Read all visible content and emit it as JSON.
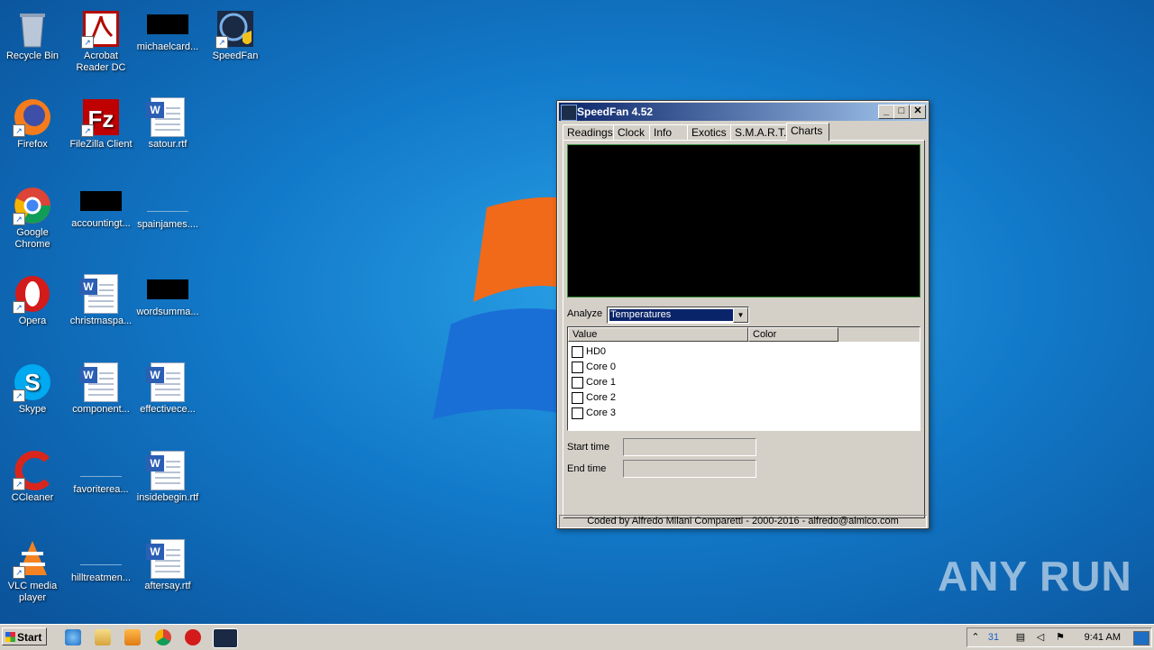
{
  "desktop": {
    "icons": [
      {
        "label": "Recycle Bin",
        "icon": "recycle-bin-icon"
      },
      {
        "label": "Acrobat Reader DC",
        "icon": "acrobat-icon"
      },
      {
        "label": "michaelcard...",
        "icon": "blank-file-icon"
      },
      {
        "label": "SpeedFan",
        "icon": "speedfan-icon"
      },
      {
        "label": "Firefox",
        "icon": "firefox-icon"
      },
      {
        "label": "FileZilla Client",
        "icon": "filezilla-icon"
      },
      {
        "label": "satour.rtf",
        "icon": "word-doc-icon"
      },
      {
        "label": "Google Chrome",
        "icon": "chrome-icon"
      },
      {
        "label": "accountingt...",
        "icon": "blank-file-icon"
      },
      {
        "label": "spainjames....",
        "icon": "blank-file-icon"
      },
      {
        "label": "Opera",
        "icon": "opera-icon"
      },
      {
        "label": "christmaspa...",
        "icon": "word-doc-icon"
      },
      {
        "label": "wordsumma...",
        "icon": "blank-file-icon"
      },
      {
        "label": "Skype",
        "icon": "skype-icon"
      },
      {
        "label": "component...",
        "icon": "word-doc-icon"
      },
      {
        "label": "effectivece...",
        "icon": "word-doc-icon"
      },
      {
        "label": "CCleaner",
        "icon": "ccleaner-icon"
      },
      {
        "label": "favoriterea...",
        "icon": "blank-file-icon"
      },
      {
        "label": "insidebegin.rtf",
        "icon": "word-doc-icon"
      },
      {
        "label": "VLC media player",
        "icon": "vlc-icon"
      },
      {
        "label": "hilltreatmen...",
        "icon": "blank-file-icon"
      },
      {
        "label": "aftersay.rtf",
        "icon": "word-doc-icon"
      }
    ]
  },
  "window": {
    "title": "SpeedFan 4.52",
    "tabs": [
      "Readings",
      "Clock",
      "Info",
      "Exotics",
      "S.M.A.R.T.",
      "Charts"
    ],
    "active_tab": "Charts",
    "analyze_label": "Analyze",
    "analyze_value": "Temperatures",
    "columns": [
      "Value",
      "Color"
    ],
    "rows": [
      "HD0",
      "Core 0",
      "Core 1",
      "Core 2",
      "Core 3"
    ],
    "start_time_label": "Start time",
    "end_time_label": "End time",
    "status": "Coded by Alfredo Milani Comparetti - 2000-2016 - alfredo@almico.com"
  },
  "taskbar": {
    "start_label": "Start",
    "clock": "9:41 AM"
  },
  "watermark": "ANY RUN"
}
